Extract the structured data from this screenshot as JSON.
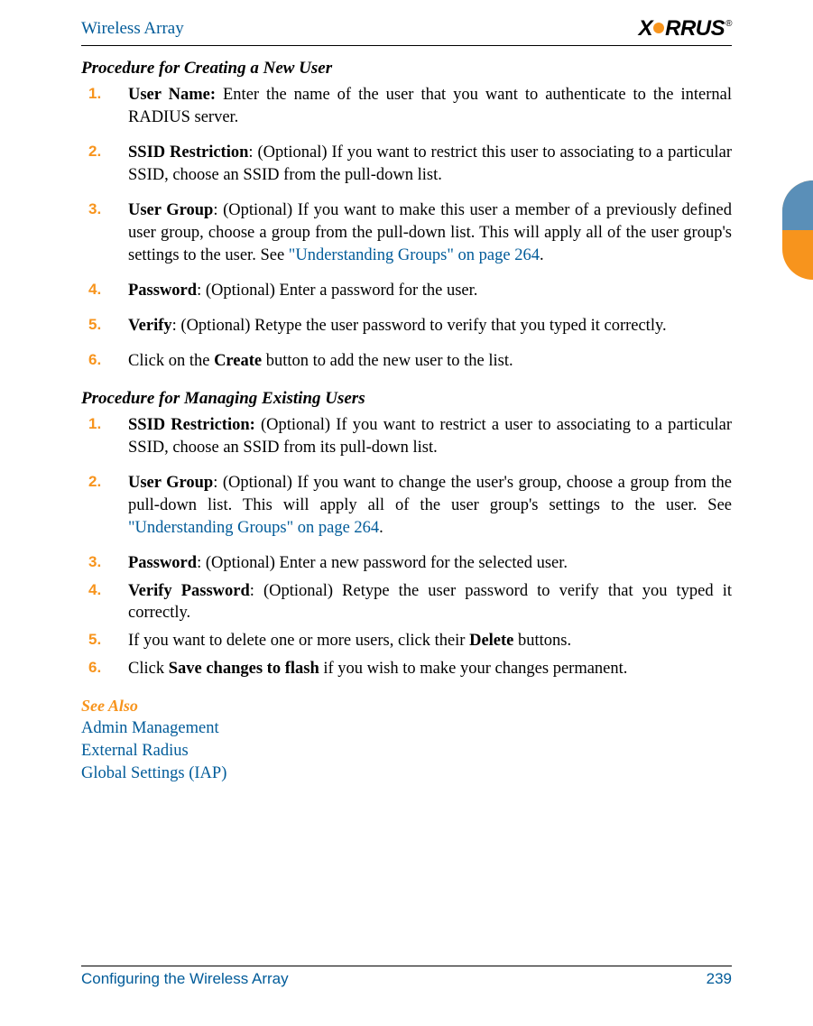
{
  "header": {
    "running_title": "Wireless Array",
    "logo_text": "XIRRUS",
    "logo_reg": "®"
  },
  "sections": [
    {
      "heading": "Procedure for Creating a New User",
      "steps": [
        {
          "num": "1.",
          "label": "User Name:",
          "text": " Enter the name of the user that you want to authenticate to the internal RADIUS server."
        },
        {
          "num": "2.",
          "label": "SSID Restriction",
          "text": ": (Optional) If you want to restrict this user to associating to a particular SSID, choose an SSID from the pull-down list."
        },
        {
          "num": "3.",
          "label": "User Group",
          "text": ": (Optional) If you want to make this user a member of a previously defined user group, choose a group from the pull-down list. This will apply all of the user group's settings to the user. See ",
          "link": "\"Understanding Groups\" on page 264",
          "after_link": "."
        },
        {
          "num": "4.",
          "label": "Password",
          "text": ": (Optional) Enter a password for the user."
        },
        {
          "num": "5.",
          "label": "Verify",
          "text": ": (Optional) Retype the user password to verify that you typed it correctly."
        },
        {
          "num": "6.",
          "prefix": "Click on the ",
          "bold_mid": "Create",
          "text": " button to add the new user to the list."
        }
      ]
    },
    {
      "heading": "Procedure for Managing Existing Users",
      "steps": [
        {
          "num": "1.",
          "label": "SSID Restriction:",
          "text": " (Optional) If you want to restrict a user to associating to a particular SSID, choose an SSID from its pull-down list."
        },
        {
          "num": "2.",
          "label": "User Group",
          "text": ": (Optional) If you want to change the user's group, choose a group from the pull-down list. This will apply all of the user group's settings to the user. See ",
          "link": "\"Understanding Groups\" on page 264",
          "after_link": "."
        },
        {
          "num": "3.",
          "label": "Password",
          "text": ": (Optional) Enter a new password for the selected user."
        },
        {
          "num": "4.",
          "label": "Verify Password",
          "text": ": (Optional) Retype the user password to verify that you typed it correctly."
        },
        {
          "num": "5.",
          "prefix": "If you want to delete one or more users, click their ",
          "bold_mid": "Delete",
          "text": " buttons."
        },
        {
          "num": "6.",
          "prefix": "Click ",
          "bold_mid": "Save changes to flash",
          "text": " if you wish to make your changes permanent."
        }
      ]
    }
  ],
  "see_also": {
    "heading": "See Also",
    "links": [
      "Admin Management",
      "External Radius",
      "Global Settings (IAP)"
    ]
  },
  "footer": {
    "left": "Configuring the Wireless Array",
    "right": "239"
  }
}
